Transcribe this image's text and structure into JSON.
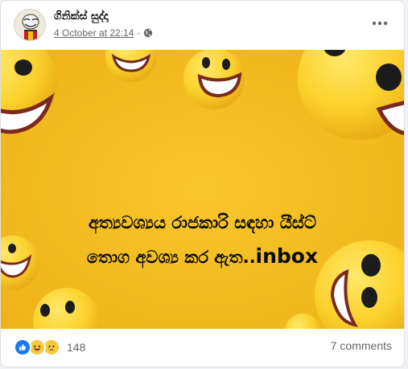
{
  "post": {
    "page_name": "ගිනික්ස් සුද්දා",
    "timestamp": "4 October at 22:14",
    "separator": "·",
    "audience_icon": "public-globe-icon",
    "more_icon": "more-horizontal-icon"
  },
  "image": {
    "background_color": "#f3bd20",
    "emoji": "laughing-face",
    "caption_line_1": "අත්‍යවශ්‍යය රාජකාරි සඳහා යීස්ට්",
    "caption_line_2_prefix": "තොග අවශ්‍ය කර ඇත..",
    "caption_line_2_suffix": "inbox"
  },
  "footer": {
    "reaction_icons": [
      "like-icon",
      "haha-icon",
      "sad-icon"
    ],
    "reaction_count": "148",
    "comments_label": "7 comments"
  }
}
